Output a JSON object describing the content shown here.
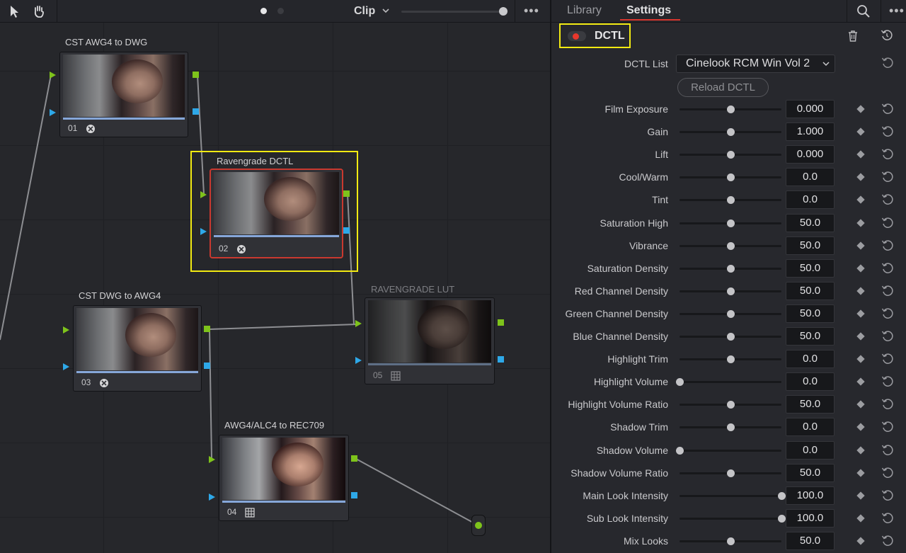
{
  "toolbar": {
    "pointer_icon": "pointer-icon",
    "hand_icon": "hand-icon",
    "clip_label": "Clip",
    "more_label": "•••"
  },
  "nodes": [
    {
      "id": "01",
      "title": "CST AWG4 to DWG",
      "badge": "fx-icon"
    },
    {
      "id": "02",
      "title": "Ravengrade DCTL",
      "badge": "fx-icon",
      "selected": true
    },
    {
      "id": "03",
      "title": "CST DWG to AWG4",
      "badge": "fx-icon"
    },
    {
      "id": "05",
      "title": "RAVENGRADE LUT",
      "badge": "lut-grid-icon",
      "disabled": true
    },
    {
      "id": "04",
      "title": "AWG4/ALC4 to REC709",
      "badge": "lut-grid-icon"
    }
  ],
  "panel": {
    "tabs": [
      "Library",
      "Settings"
    ],
    "active_tab": "Settings",
    "more_label": "•••",
    "dctl_title": "DCTL",
    "dctl_list_label": "DCTL List",
    "dctl_list_value": "Cinelook RCM Win Vol 2",
    "reload_label": "Reload DCTL",
    "colors": {
      "accent": "#d8362e",
      "highlight": "#f2ea12",
      "node_green": "#7ec31b",
      "node_blue": "#2ea8e8"
    }
  },
  "params": [
    {
      "label": "Film Exposure",
      "value": "0.000",
      "level": 0.5
    },
    {
      "label": "Gain",
      "value": "1.000",
      "level": 0.5
    },
    {
      "label": "Lift",
      "value": "0.000",
      "level": 0.5
    },
    {
      "label": "Cool/Warm",
      "value": "0.0",
      "level": 0.5
    },
    {
      "label": "Tint",
      "value": "0.0",
      "level": 0.5
    },
    {
      "label": "Saturation High",
      "value": "50.0",
      "level": 0.5
    },
    {
      "label": "Vibrance",
      "value": "50.0",
      "level": 0.5
    },
    {
      "label": "Saturation Density",
      "value": "50.0",
      "level": 0.5
    },
    {
      "label": "Red Channel Density",
      "value": "50.0",
      "level": 0.5
    },
    {
      "label": "Green Channel Density",
      "value": "50.0",
      "level": 0.5
    },
    {
      "label": "Blue Channel Density",
      "value": "50.0",
      "level": 0.5
    },
    {
      "label": "Highlight Trim",
      "value": "0.0",
      "level": 0.5
    },
    {
      "label": "Highlight Volume",
      "value": "0.0",
      "level": 0.0
    },
    {
      "label": "Highlight Volume Ratio",
      "value": "50.0",
      "level": 0.5
    },
    {
      "label": "Shadow Trim",
      "value": "0.0",
      "level": 0.5
    },
    {
      "label": "Shadow Volume",
      "value": "0.0",
      "level": 0.0
    },
    {
      "label": "Shadow Volume Ratio",
      "value": "50.0",
      "level": 0.5
    },
    {
      "label": "Main Look Intensity",
      "value": "100.0",
      "level": 1.0
    },
    {
      "label": "Sub Look Intensity",
      "value": "100.0",
      "level": 1.0
    },
    {
      "label": "Mix Looks",
      "value": "50.0",
      "level": 0.5
    }
  ]
}
